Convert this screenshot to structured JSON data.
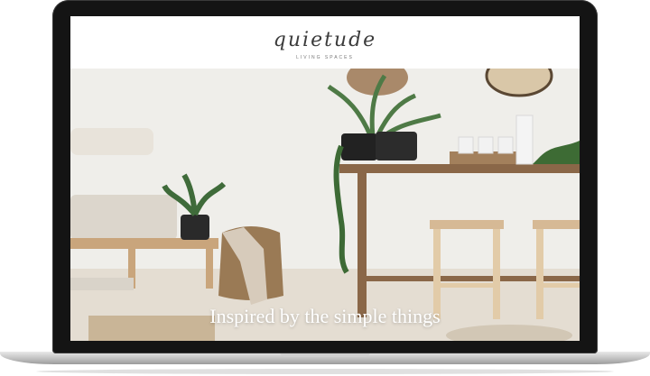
{
  "brand": {
    "logo_text": "quietude",
    "tagline": "LIVING SPACES"
  },
  "hero": {
    "headline": "Inspired by the simple things"
  }
}
